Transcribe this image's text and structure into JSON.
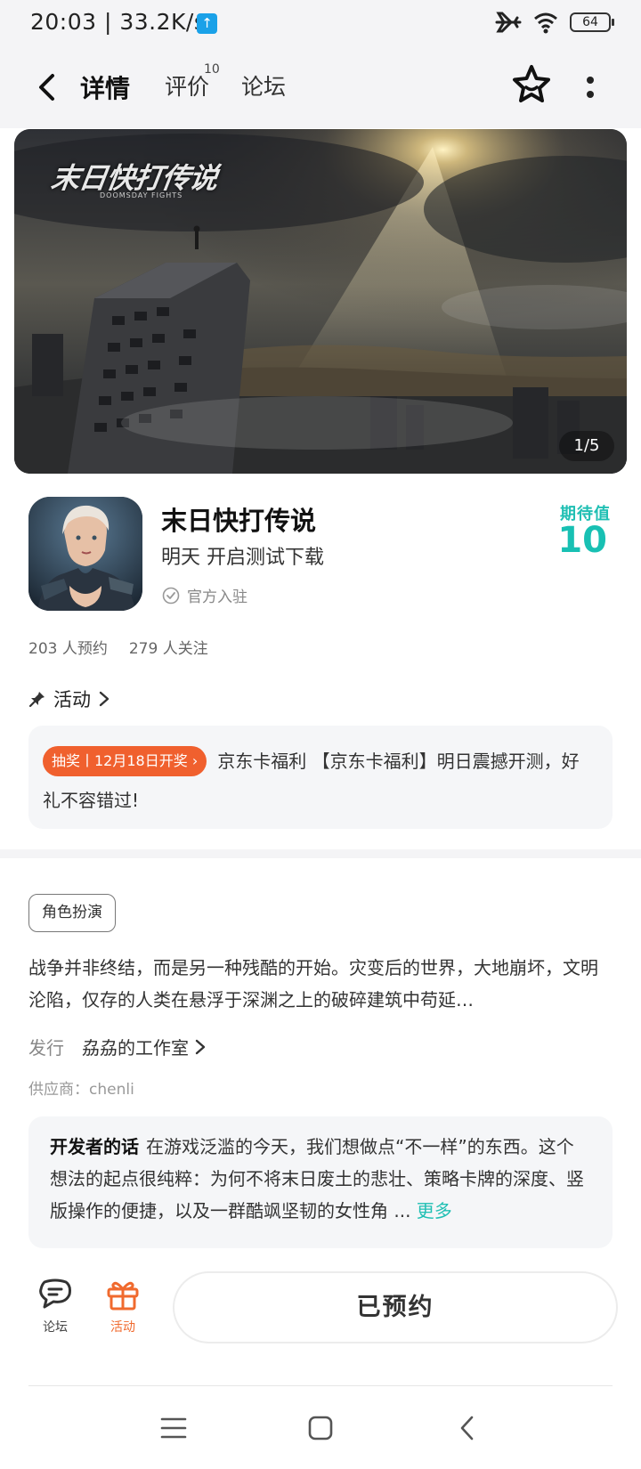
{
  "status_bar": {
    "time_speed": "20:03 | 33.2K/s",
    "battery": "64"
  },
  "nav": {
    "tabs": [
      {
        "label": "详情",
        "active": true
      },
      {
        "label": "评价",
        "badge": "10"
      },
      {
        "label": "论坛"
      }
    ]
  },
  "banner": {
    "logo_text": "末日快打传说",
    "logo_subtext": "DOOMSDAY FIGHTS",
    "counter": "1/5"
  },
  "game": {
    "title": "末日快打传说",
    "subtitle": "明天 开启测试下载",
    "official": "官方入驻",
    "expect_label": "期待值",
    "expect_value": "10"
  },
  "stats": {
    "reservations": "203 人预约",
    "followers": "279 人关注"
  },
  "activity": {
    "heading": "活动",
    "tag": "抽奖丨12月18日开奖",
    "text": "京东卡福利 【京东卡福利】明日震撼开测，好礼不容错过!"
  },
  "genre_tag": "角色扮演",
  "description": "战争并非终结，而是另一种残酷的开始。灾变后的世界，大地崩坏，文明沦陷，仅存的人类在悬浮于深渊之上的破碎建筑中苟延…",
  "publisher": {
    "label": "发行",
    "name": "劦劦的工作室"
  },
  "supplier": "供应商：chenli",
  "developer_note": {
    "title": "开发者的话",
    "text": "在游戏泛滥的今天，我们想做点“不一样”的东西。这个想法的起点很纯粹：为何不将末日废土的悲壮、策略卡牌的深度、竖版操作的便捷，以及一群酷飒坚韧的女性角 ...",
    "more": "更多"
  },
  "bottom_bar": {
    "forum_label": "论坛",
    "activity_label": "活动",
    "reserve_button": "已预约"
  },
  "colors": {
    "accent_teal": "#1fbfb3",
    "lottery_orange": "#f0602e",
    "activity_orange": "#f06a2e"
  }
}
